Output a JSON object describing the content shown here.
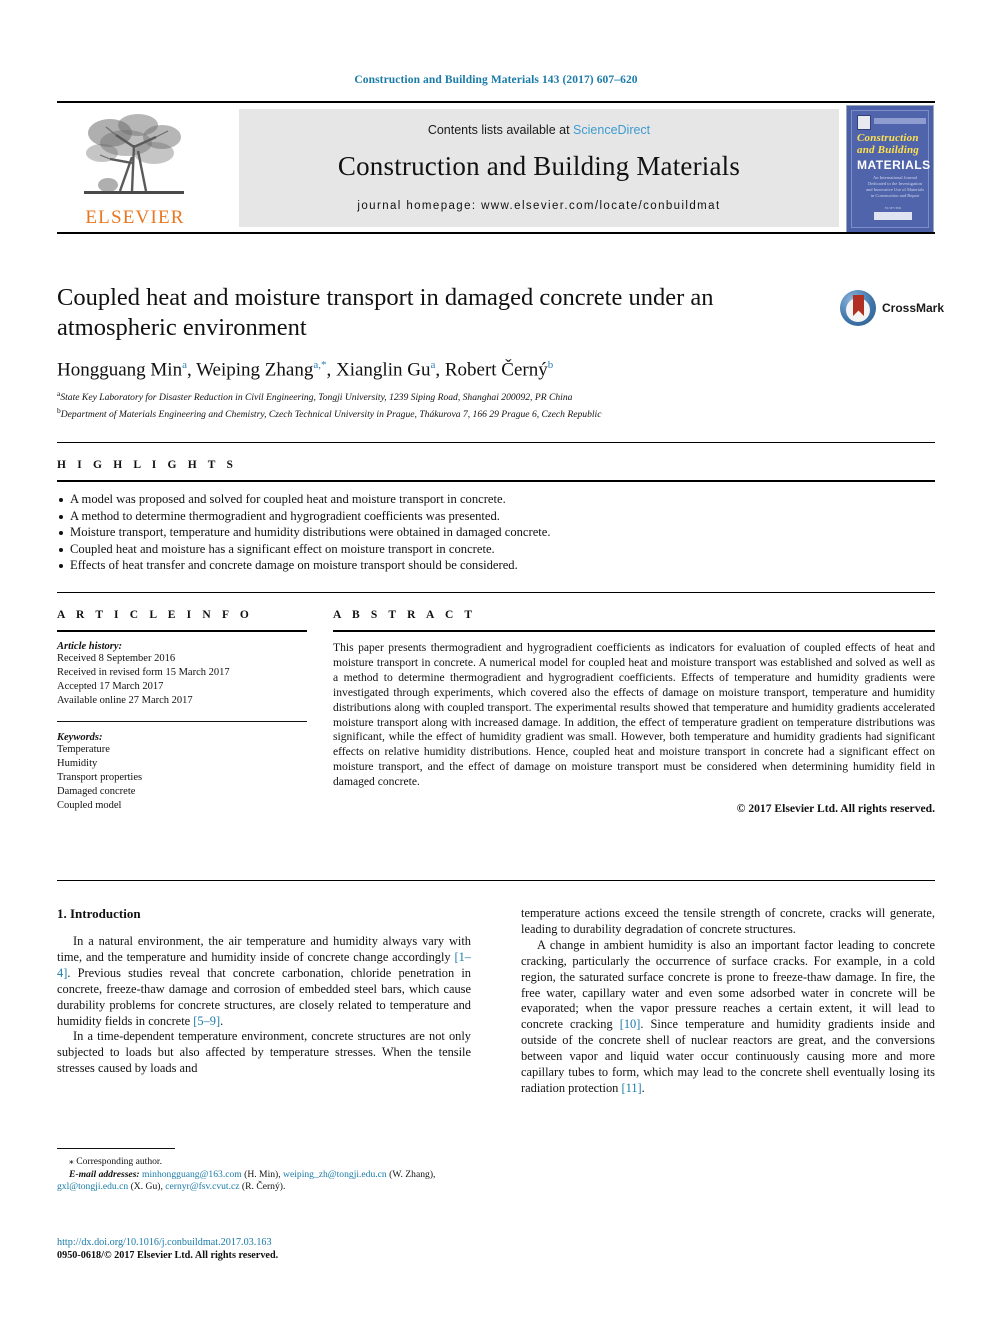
{
  "running_head": "Construction and Building Materials 143 (2017) 607–620",
  "masthead": {
    "contents_prefix": "Contents lists available at",
    "sciencedirect": "ScienceDirect",
    "journal_title": "Construction and Building Materials",
    "homepage": "journal homepage: www.elsevier.com/locate/conbuildmat",
    "publisher_wordmark": "ELSEVIER",
    "cover": {
      "line1": "Construction",
      "line2": "and Building",
      "line3": "MATERIALS",
      "blurb": "An International Journal Dedicated to the Investigation and Innovative Use of Materials in Construction and Repair",
      "footer": "ELSEVIER"
    }
  },
  "article": {
    "title": "Coupled heat and moisture transport in damaged concrete under an atmospheric environment",
    "crossmark_label": "CrossMark",
    "authors": [
      {
        "name": "Hongguang Min",
        "marks": "a"
      },
      {
        "name": "Weiping Zhang",
        "marks": "a,*"
      },
      {
        "name": "Xianglin Gu",
        "marks": "a"
      },
      {
        "name": "Robert Černý",
        "marks": "b"
      }
    ],
    "affiliations": [
      {
        "mark": "a",
        "text": "State Key Laboratory for Disaster Reduction in Civil Engineering, Tongji University, 1239 Siping Road, Shanghai 200092, PR China"
      },
      {
        "mark": "b",
        "text": "Department of Materials Engineering and Chemistry, Czech Technical University in Prague, Thákurova 7, 166 29 Prague 6, Czech Republic"
      }
    ]
  },
  "highlights": {
    "label": "H I G H L I G H T S",
    "items": [
      "A model was proposed and solved for coupled heat and moisture transport in concrete.",
      "A method to determine thermogradient and hygrogradient coefficients was presented.",
      "Moisture transport, temperature and humidity distributions were obtained in damaged concrete.",
      "Coupled heat and moisture has a significant effect on moisture transport in concrete.",
      "Effects of heat transfer and concrete damage on moisture transport should be considered."
    ]
  },
  "article_info": {
    "label": "A R T I C L E    I N F O",
    "history_title": "Article history:",
    "history": [
      "Received 8 September 2016",
      "Received in revised form 15 March 2017",
      "Accepted 17 March 2017",
      "Available online 27 March 2017"
    ],
    "keywords_title": "Keywords:",
    "keywords": [
      "Temperature",
      "Humidity",
      "Transport properties",
      "Damaged concrete",
      "Coupled model"
    ]
  },
  "abstract": {
    "label": "A B S T R A C T",
    "text": "This paper presents thermogradient and hygrogradient coefficients as indicators for evaluation of coupled effects of heat and moisture transport in concrete. A numerical model for coupled heat and moisture transport was established and solved as well as a method to determine thermogradient and hygrogradient coefficients. Effects of temperature and humidity gradients were investigated through experiments, which covered also the effects of damage on moisture transport, temperature and humidity distributions along with coupled transport. The experimental results showed that temperature and humidity gradients accelerated moisture transport along with increased damage. In addition, the effect of temperature gradient on temperature distributions was significant, while the effect of humidity gradient was small. However, both temperature and humidity gradients had significant effects on relative humidity distributions. Hence, coupled heat and moisture transport in concrete had a significant effect on moisture transport, and the effect of damage on moisture transport must be considered when determining humidity field in damaged concrete.",
    "copyright": "© 2017 Elsevier Ltd. All rights reserved."
  },
  "body": {
    "section_heading": "1. Introduction",
    "left_paragraphs": [
      "In a natural environment, the air temperature and humidity always vary with time, and the temperature and humidity inside of concrete change accordingly [1–4]. Previous studies reveal that concrete carbonation, chloride penetration in concrete, freeze-thaw damage and corrosion of embedded steel bars, which cause durability problems for concrete structures, are closely related to temperature and humidity fields in concrete [5–9].",
      "In a time-dependent temperature environment, concrete structures are not only subjected to loads but also affected by temperature stresses. When the tensile stresses caused by loads and"
    ],
    "right_paragraphs": [
      "temperature actions exceed the tensile strength of concrete, cracks will generate, leading to durability degradation of concrete structures.",
      "A change in ambient humidity is also an important factor leading to concrete cracking, particularly the occurrence of surface cracks. For example, in a cold region, the saturated surface concrete is prone to freeze-thaw damage. In fire, the free water, capillary water and even some adsorbed water in concrete will be evaporated; when the vapor pressure reaches a certain extent, it will lead to concrete cracking [10]. Since temperature and humidity gradients inside and outside of the concrete shell of nuclear reactors are great, and the conversions between vapor and liquid water occur continuously causing more and more capillary tubes to form, which may lead to the concrete shell eventually losing its radiation protection [11]."
    ]
  },
  "footnote": {
    "corresponding": "⁎ Corresponding author.",
    "email_label": "E-mail addresses:",
    "emails": [
      {
        "address": "minhongguang@163.com",
        "owner": "(H. Min)"
      },
      {
        "address": "weiping_zh@tongji.edu.cn",
        "owner": "(W. Zhang)"
      },
      {
        "address": "gxl@tongji.edu.cn",
        "owner": "(X. Gu)"
      },
      {
        "address": "cernyr@fsv.cvut.cz",
        "owner": "(R. Černý)"
      }
    ],
    "doi": "http://dx.doi.org/10.1016/j.conbuildmat.2017.03.163",
    "issn": "0950-0618/© 2017 Elsevier Ltd. All rights reserved."
  },
  "colors": {
    "link_blue": "#1a7ba8",
    "sciencedirect_blue": "#3d9bd1",
    "elsevier_orange": "#e87722",
    "cover_blue": "#5064ab",
    "cover_yellow": "#ffe14d"
  }
}
